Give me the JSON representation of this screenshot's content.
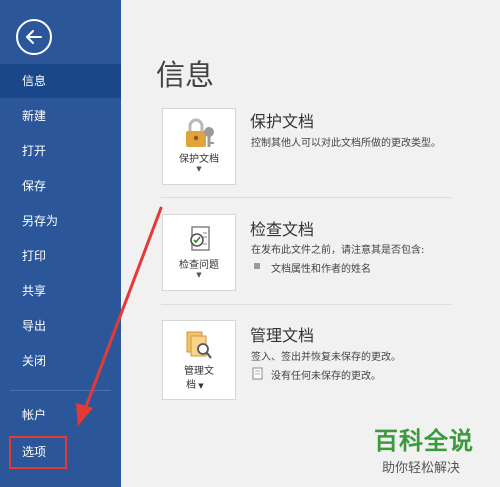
{
  "sidebar": {
    "back_icon": "arrow-left-circle-icon",
    "items": [
      {
        "label": "信息"
      },
      {
        "label": "新建"
      },
      {
        "label": "打开"
      },
      {
        "label": "保存"
      },
      {
        "label": "另存为"
      },
      {
        "label": "打印"
      },
      {
        "label": "共享"
      },
      {
        "label": "导出"
      },
      {
        "label": "关闭"
      }
    ],
    "account_label": "帐户",
    "options_label": "选项",
    "active_item": "信息",
    "color": "#2b579a",
    "highlight_color": "#e53935"
  },
  "main": {
    "title": "信息",
    "sections": [
      {
        "button_label": "保护文档",
        "title": "保护文档",
        "description": "控制其他人可以对此文档所做的更改类型。",
        "icon": "lock-key-icon"
      },
      {
        "button_label": "检查问题",
        "title": "检查文档",
        "description": "在发布此文件之前，请注意其是否包含:",
        "bullet": "文档属性和作者的姓名",
        "icon": "document-check-icon"
      },
      {
        "button_label_line1": "管理文",
        "button_label_line2": "档",
        "title": "管理文档",
        "description": "签入、签出并恢复未保存的更改。",
        "note": "没有任何未保存的更改。",
        "icon": "documents-search-icon"
      }
    ]
  },
  "watermark": {
    "main": "百科全说",
    "sub": "助你轻松解决"
  }
}
